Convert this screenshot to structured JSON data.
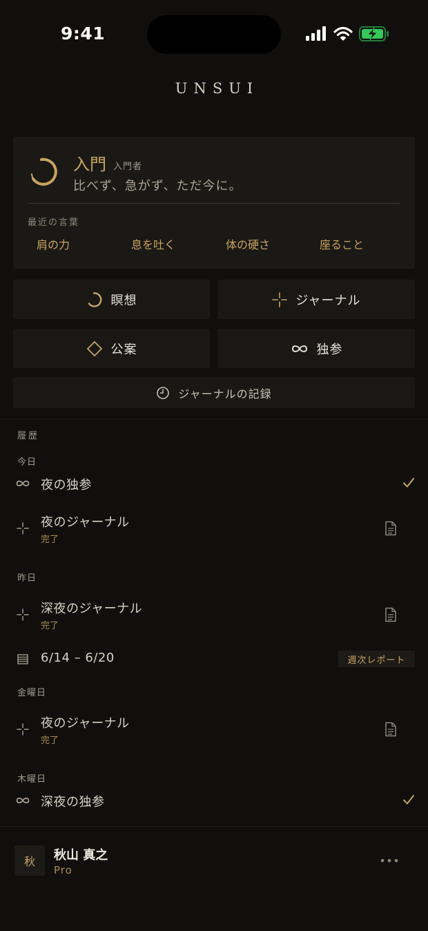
{
  "status_bar": {
    "time": "9:41"
  },
  "app": {
    "title": "UNSUI"
  },
  "level": {
    "name": "入門",
    "sub": "入門者",
    "motto": "比べず、急がず、ただ今に。",
    "recent_label": "最近の言葉",
    "recent_words": [
      "肩の力",
      "息を吐く",
      "体の硬さ",
      "座ること"
    ]
  },
  "actions": {
    "meditation": "瞑想",
    "journal": "ジャーナル",
    "koan": "公案",
    "dokusan": "独参",
    "journal_record": "ジャーナルの記録"
  },
  "history": {
    "title": "履歴",
    "groups": [
      {
        "label": "今日"
      },
      {
        "label": "昨日"
      },
      {
        "label": "金曜日"
      },
      {
        "label": "木曜日"
      }
    ],
    "items": [
      {
        "icon": "infinity-icon",
        "title": "夜の独参",
        "right": "checkmark-icon"
      },
      {
        "icon": "sparkle-icon",
        "title": "夜のジャーナル",
        "sub": "完了",
        "right": "document-icon"
      },
      {
        "icon": "sparkle-icon",
        "title": "深夜のジャーナル",
        "sub": "完了",
        "right": "document-icon"
      },
      {
        "icon": "report-icon",
        "title": "6/14 – 6/20",
        "right_label": "週次レポート"
      },
      {
        "icon": "sparkle-icon",
        "title": "夜のジャーナル",
        "sub": "完了",
        "right": "document-icon"
      },
      {
        "icon": "infinity-icon",
        "title": "深夜の独参",
        "right": "checkmark-icon"
      }
    ]
  },
  "user": {
    "initial": "秋",
    "name": "秋山 真之",
    "plan": "Pro"
  },
  "colors": {
    "accent": "#c9a461",
    "background": "#100f0d",
    "card": "#1b1915",
    "battery": "#34c759"
  }
}
